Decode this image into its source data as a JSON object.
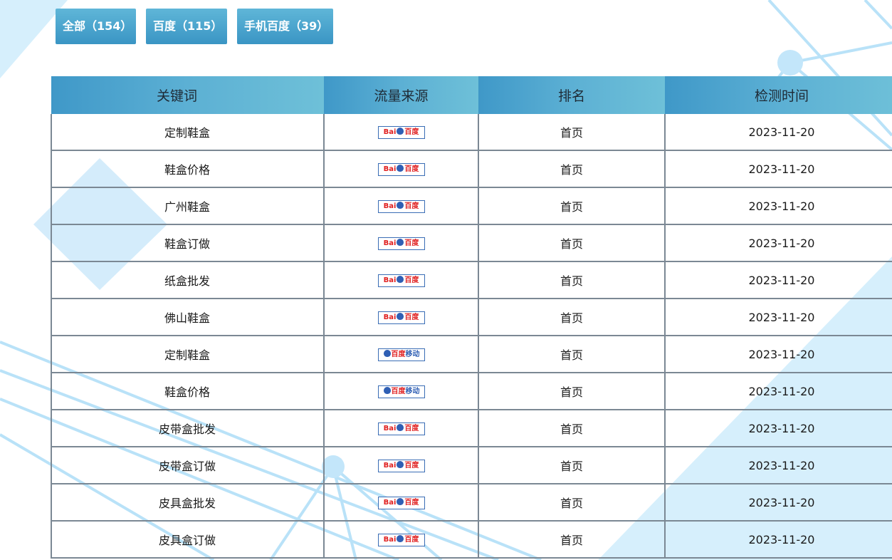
{
  "tabs": [
    {
      "label": "全部（154）"
    },
    {
      "label": "百度（115）"
    },
    {
      "label": "手机百度（39）"
    }
  ],
  "table": {
    "headers": [
      "关键词",
      "流量来源",
      "排名",
      "检测时间"
    ],
    "rows": [
      {
        "keyword": "定制鞋盒",
        "source": "baidu",
        "rank": "首页",
        "date": "2023-11-20"
      },
      {
        "keyword": "鞋盒价格",
        "source": "baidu",
        "rank": "首页",
        "date": "2023-11-20"
      },
      {
        "keyword": "广州鞋盒",
        "source": "baidu",
        "rank": "首页",
        "date": "2023-11-20"
      },
      {
        "keyword": "鞋盒订做",
        "source": "baidu",
        "rank": "首页",
        "date": "2023-11-20"
      },
      {
        "keyword": "纸盒批发",
        "source": "baidu",
        "rank": "首页",
        "date": "2023-11-20"
      },
      {
        "keyword": "佛山鞋盒",
        "source": "baidu",
        "rank": "首页",
        "date": "2023-11-20"
      },
      {
        "keyword": "定制鞋盒",
        "source": "baidu-mobile",
        "rank": "首页",
        "date": "2023-11-20"
      },
      {
        "keyword": "鞋盒价格",
        "source": "baidu-mobile",
        "rank": "首页",
        "date": "2023-11-20"
      },
      {
        "keyword": "皮带盒批发",
        "source": "baidu",
        "rank": "首页",
        "date": "2023-11-20"
      },
      {
        "keyword": "皮带盒订做",
        "source": "baidu",
        "rank": "首页",
        "date": "2023-11-20"
      },
      {
        "keyword": "皮具盒批发",
        "source": "baidu",
        "rank": "首页",
        "date": "2023-11-20"
      },
      {
        "keyword": "皮具盒订做",
        "source": "baidu",
        "rank": "首页",
        "date": "2023-11-20"
      }
    ]
  },
  "badges": {
    "baidu": {
      "part1": "Bai",
      "part2": "百度"
    },
    "baidu-mobile": {
      "part1": "",
      "part2": "百度",
      "part3": "移动"
    }
  },
  "colors": {
    "tab_bg": "#4aa5cf",
    "header_bg": "#4fa7cf",
    "grid": "#7b8894",
    "bg_accent": "#bfe6fb"
  }
}
